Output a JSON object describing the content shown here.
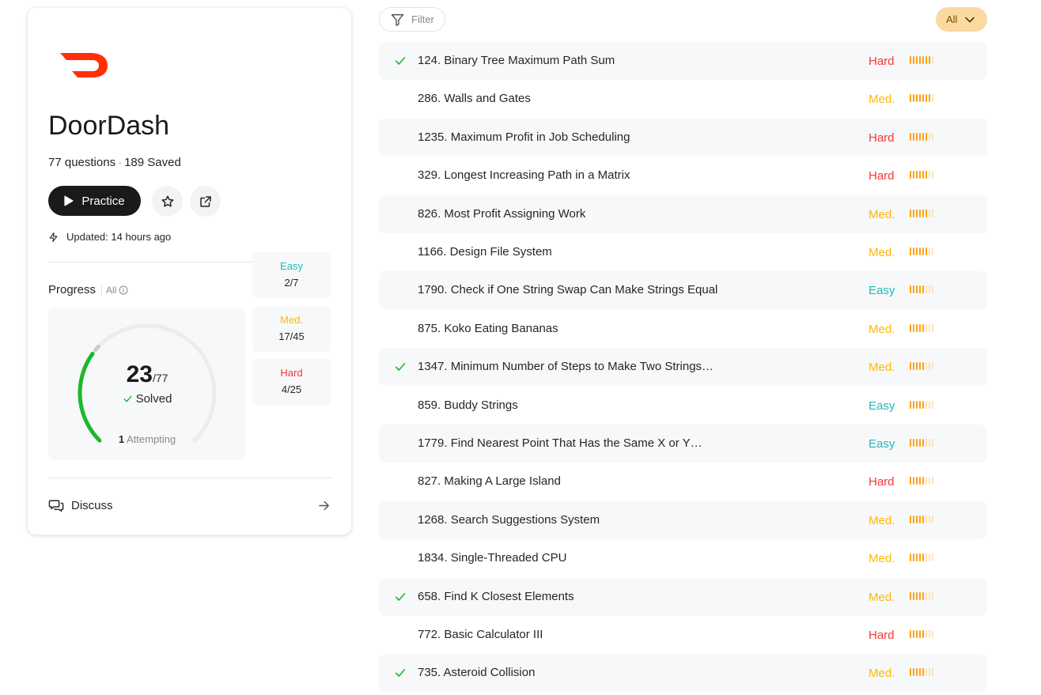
{
  "company": {
    "name": "DoorDash",
    "questions_text": "77 questions",
    "saved_text": "189 Saved",
    "brand_color": "#ff3008"
  },
  "actions": {
    "practice_label": "Practice",
    "favorite_icon": "star-icon",
    "share_icon": "external-link-icon"
  },
  "updated_text": "Updated: 14 hours ago",
  "progress": {
    "title": "Progress",
    "filter_label": "All",
    "solved": "23",
    "total": "/77",
    "solved_label": "Solved",
    "attempting_count": "1",
    "attempting_label": "Attempting",
    "solved_fraction": 0.299,
    "colors": {
      "easy": "#1cbaba",
      "medium": "#ffb800",
      "hard": "#f63737",
      "ring": "#1cb82c"
    },
    "breakdown": [
      {
        "label": "Easy",
        "value": "2/7",
        "difficulty": "easy"
      },
      {
        "label": "Med.",
        "value": "17/45",
        "difficulty": "medium"
      },
      {
        "label": "Hard",
        "value": "4/25",
        "difficulty": "hard"
      }
    ]
  },
  "discuss_label": "Discuss",
  "toolbar": {
    "filter_label": "Filter",
    "sort_label": "All"
  },
  "problems": [
    {
      "title": "124. Binary Tree Maximum Path Sum",
      "difficulty": "Hard",
      "solved": true,
      "frequency": 7
    },
    {
      "title": "286. Walls and Gates",
      "difficulty": "Med.",
      "solved": false,
      "frequency": 7
    },
    {
      "title": "1235. Maximum Profit in Job Scheduling",
      "difficulty": "Hard",
      "solved": false,
      "frequency": 6
    },
    {
      "title": "329. Longest Increasing Path in a Matrix",
      "difficulty": "Hard",
      "solved": false,
      "frequency": 6
    },
    {
      "title": "826. Most Profit Assigning Work",
      "difficulty": "Med.",
      "solved": false,
      "frequency": 6
    },
    {
      "title": "1166. Design File System",
      "difficulty": "Med.",
      "solved": false,
      "frequency": 6
    },
    {
      "title": "1790. Check if One String Swap Can Make Strings Equal",
      "difficulty": "Easy",
      "solved": false,
      "frequency": 5
    },
    {
      "title": "875. Koko Eating Bananas",
      "difficulty": "Med.",
      "solved": false,
      "frequency": 5
    },
    {
      "title": "1347. Minimum Number of Steps to Make Two Strings…",
      "difficulty": "Med.",
      "solved": true,
      "frequency": 5
    },
    {
      "title": "859. Buddy Strings",
      "difficulty": "Easy",
      "solved": false,
      "frequency": 5
    },
    {
      "title": "1779. Find Nearest Point That Has the Same X or Y…",
      "difficulty": "Easy",
      "solved": false,
      "frequency": 5
    },
    {
      "title": "827. Making A Large Island",
      "difficulty": "Hard",
      "solved": false,
      "frequency": 5
    },
    {
      "title": "1268. Search Suggestions System",
      "difficulty": "Med.",
      "solved": false,
      "frequency": 5
    },
    {
      "title": "1834. Single-Threaded CPU",
      "difficulty": "Med.",
      "solved": false,
      "frequency": 5
    },
    {
      "title": "658. Find K Closest Elements",
      "difficulty": "Med.",
      "solved": true,
      "frequency": 5
    },
    {
      "title": "772. Basic Calculator III",
      "difficulty": "Hard",
      "solved": false,
      "frequency": 5
    },
    {
      "title": "735. Asteroid Collision",
      "difficulty": "Med.",
      "solved": true,
      "frequency": 5
    }
  ]
}
